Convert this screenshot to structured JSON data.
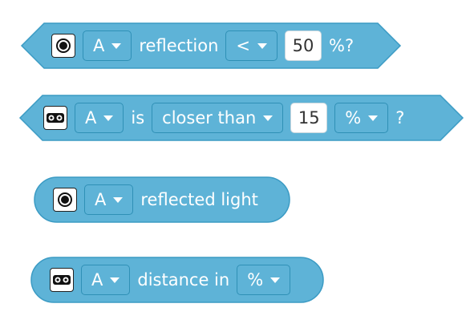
{
  "colors": {
    "block_fill": "#5eb3d7",
    "block_stroke": "#3b9bc4",
    "field_stroke": "#2f90b6",
    "text": "#ffffff"
  },
  "blocks": [
    {
      "icon": "color-sensor-icon",
      "port": "A",
      "label": "reflection",
      "operator": "<",
      "value": "50",
      "suffix": "%?"
    },
    {
      "icon": "distance-sensor-icon",
      "port": "A",
      "label": "is",
      "comparison": "closer than",
      "value": "15",
      "unit": "%",
      "suffix": "?"
    },
    {
      "icon": "color-sensor-icon",
      "port": "A",
      "label": "reflected light"
    },
    {
      "icon": "distance-sensor-icon",
      "port": "A",
      "label": "distance in",
      "unit": "%"
    }
  ]
}
